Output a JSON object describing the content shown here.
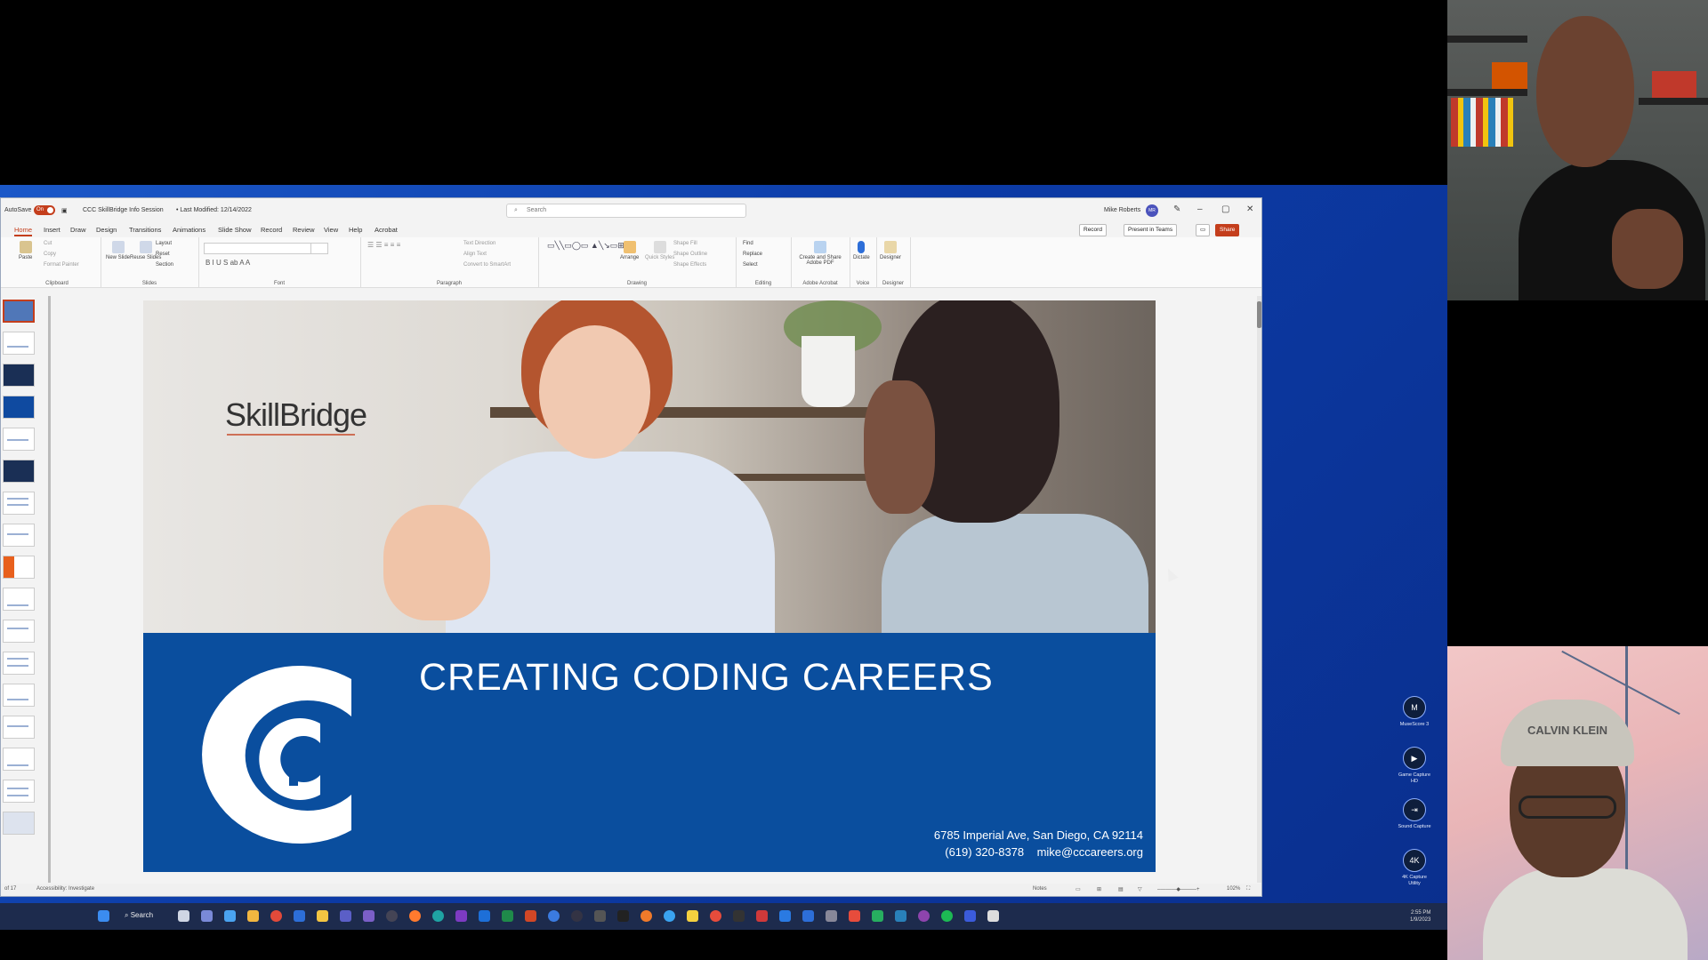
{
  "window": {
    "autosave_label": "AutoSave",
    "autosave_state": "On",
    "file_title": "CCC SkillBridge Info Session",
    "last_modified": "• Last Modified: 12/14/2022",
    "search_placeholder": "Search",
    "user_name": "Mike Roberts",
    "user_initials": "MR"
  },
  "tabs": [
    "Home",
    "Insert",
    "Draw",
    "Design",
    "Transitions",
    "Animations",
    "Slide Show",
    "Record",
    "Review",
    "View",
    "Help",
    "Acrobat"
  ],
  "toolbar_buttons": {
    "record": "Record",
    "present": "Present in Teams",
    "share": "Share"
  },
  "ribbon": {
    "groups": [
      "Clipboard",
      "Slides",
      "Font",
      "Paragraph",
      "Drawing",
      "Editing",
      "Adobe Acrobat",
      "Voice",
      "Designer"
    ],
    "clipboard": {
      "paste": "Paste",
      "cut": "Cut",
      "copy": "Copy",
      "format_painter": "Format Painter"
    },
    "slides": {
      "new_slide": "New Slide",
      "reuse_slides": "Reuse Slides",
      "layout": "Layout",
      "reset": "Reset",
      "section": "Section"
    },
    "paragraph": {
      "text_direction": "Text Direction",
      "align_text": "Align Text",
      "convert_smartart": "Convert to SmartArt"
    },
    "drawing": {
      "arrange": "Arrange",
      "quick_styles": "Quick Styles",
      "shape_fill": "Shape Fill",
      "shape_outline": "Shape Outline",
      "shape_effects": "Shape Effects"
    },
    "editing": {
      "find": "Find",
      "replace": "Replace",
      "select": "Select"
    },
    "acrobat": {
      "create_share": "Create and Share Adobe PDF"
    },
    "voice": {
      "dictate": "Dictate"
    },
    "designer": {
      "designer": "Designer"
    }
  },
  "slide": {
    "brand": "SkillBridge",
    "band_title": "CREATING CODING CAREERS",
    "address": "6785 Imperial Ave, San Diego, CA 92114",
    "phone": "(619) 320-8378",
    "email": "mike@cccareers.org",
    "colors": {
      "band": "#0a4e9e",
      "accent": "#c43e1c"
    }
  },
  "status_bar": {
    "slide_count": "of 17",
    "accessibility": "Accessibility: Investigate",
    "notes": "Notes",
    "zoom": "102%"
  },
  "desktop_icons": [
    {
      "label": "MuseScore 3",
      "glyph": "M"
    },
    {
      "label": "Game Capture HD",
      "glyph": "▶"
    },
    {
      "label": "Sound Capture",
      "glyph": "⇥"
    },
    {
      "label": "4K Capture Utility",
      "glyph": "4K"
    }
  ],
  "taskbar": {
    "search": "Search",
    "time": "2:55 PM",
    "date": "1/9/2023"
  },
  "webcam_cap_text": "CALVIN KLEIN"
}
